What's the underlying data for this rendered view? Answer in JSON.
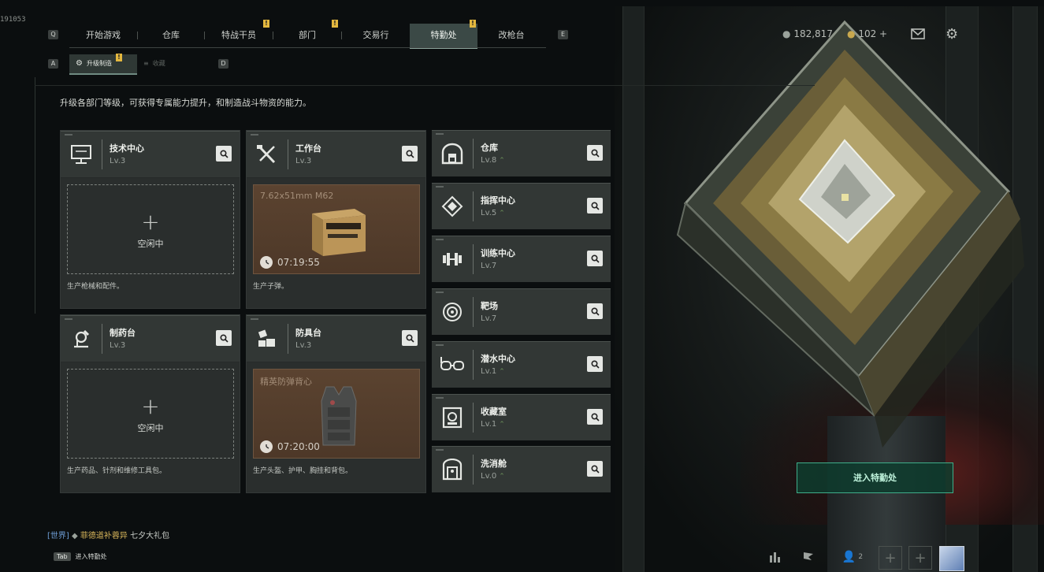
{
  "window_id": "191053",
  "nav": {
    "left_key": "Q",
    "right_key": "E",
    "tabs": [
      {
        "label": "开始游戏",
        "active": false,
        "badge": ""
      },
      {
        "label": "仓库",
        "active": false,
        "badge": ""
      },
      {
        "label": "特战干员",
        "active": false,
        "badge": "!"
      },
      {
        "label": "部门",
        "active": false,
        "badge": "!"
      },
      {
        "label": "交易行",
        "active": false,
        "badge": ""
      },
      {
        "label": "特勤处",
        "active": true,
        "badge": "!"
      },
      {
        "label": "改枪台",
        "active": false,
        "badge": ""
      }
    ]
  },
  "subnav": {
    "left_key": "A",
    "right_key": "D",
    "tabs": [
      {
        "label": "升级制造",
        "active": true,
        "badge": "!"
      },
      {
        "label": "收藏",
        "active": false
      }
    ]
  },
  "resources": {
    "currency": "182,817",
    "tokens": "102",
    "tokens_add": "+"
  },
  "intro": "升级各部门等级，可获得专属能力提升，和制造战斗物资的能力。",
  "cards": [
    {
      "name": "技术中心",
      "level": "Lv.3",
      "icon": "computer-icon",
      "state": "idle",
      "idle_label": "空闲中",
      "desc": "生产枪械和配件。"
    },
    {
      "name": "工作台",
      "level": "Lv.3",
      "icon": "tools-icon",
      "state": "producing",
      "item": "7.62x51mm M62",
      "timer": "07:19:55",
      "desc": "生产子弹。"
    },
    {
      "name": "制药台",
      "level": "Lv.3",
      "icon": "microscope-icon",
      "state": "idle",
      "idle_label": "空闲中",
      "desc": "生产药品、针剂和维修工具包。"
    },
    {
      "name": "防具台",
      "level": "Lv.3",
      "icon": "armor-parts-icon",
      "state": "producing",
      "item": "精英防弹背心",
      "timer": "07:20:00",
      "desc": "生产头盔、护甲、胸挂和背包。"
    }
  ],
  "facilities": [
    {
      "name": "仓库",
      "level": "Lv.8",
      "upgradable": true,
      "icon": "warehouse-icon"
    },
    {
      "name": "指挥中心",
      "level": "Lv.5",
      "upgradable": true,
      "icon": "command-icon"
    },
    {
      "name": "训练中心",
      "level": "Lv.7",
      "upgradable": false,
      "icon": "dumbbell-icon"
    },
    {
      "name": "靶场",
      "level": "Lv.7",
      "upgradable": false,
      "icon": "target-icon"
    },
    {
      "name": "潜水中心",
      "level": "Lv.1",
      "upgradable": true,
      "icon": "goggles-icon"
    },
    {
      "name": "收藏室",
      "level": "Lv.1",
      "upgradable": true,
      "icon": "vault-icon"
    },
    {
      "name": "洗消舱",
      "level": "Lv.0",
      "upgradable": true,
      "icon": "decon-icon"
    }
  ],
  "enter_button": "进入特勤处",
  "chat": {
    "channel": "[世界]",
    "user": "菲德道补蓉异",
    "message": "七夕大礼包"
  },
  "tab_hint": {
    "key": "Tab",
    "label": "进入特勤处"
  },
  "dock": {
    "friends_count": "2"
  }
}
